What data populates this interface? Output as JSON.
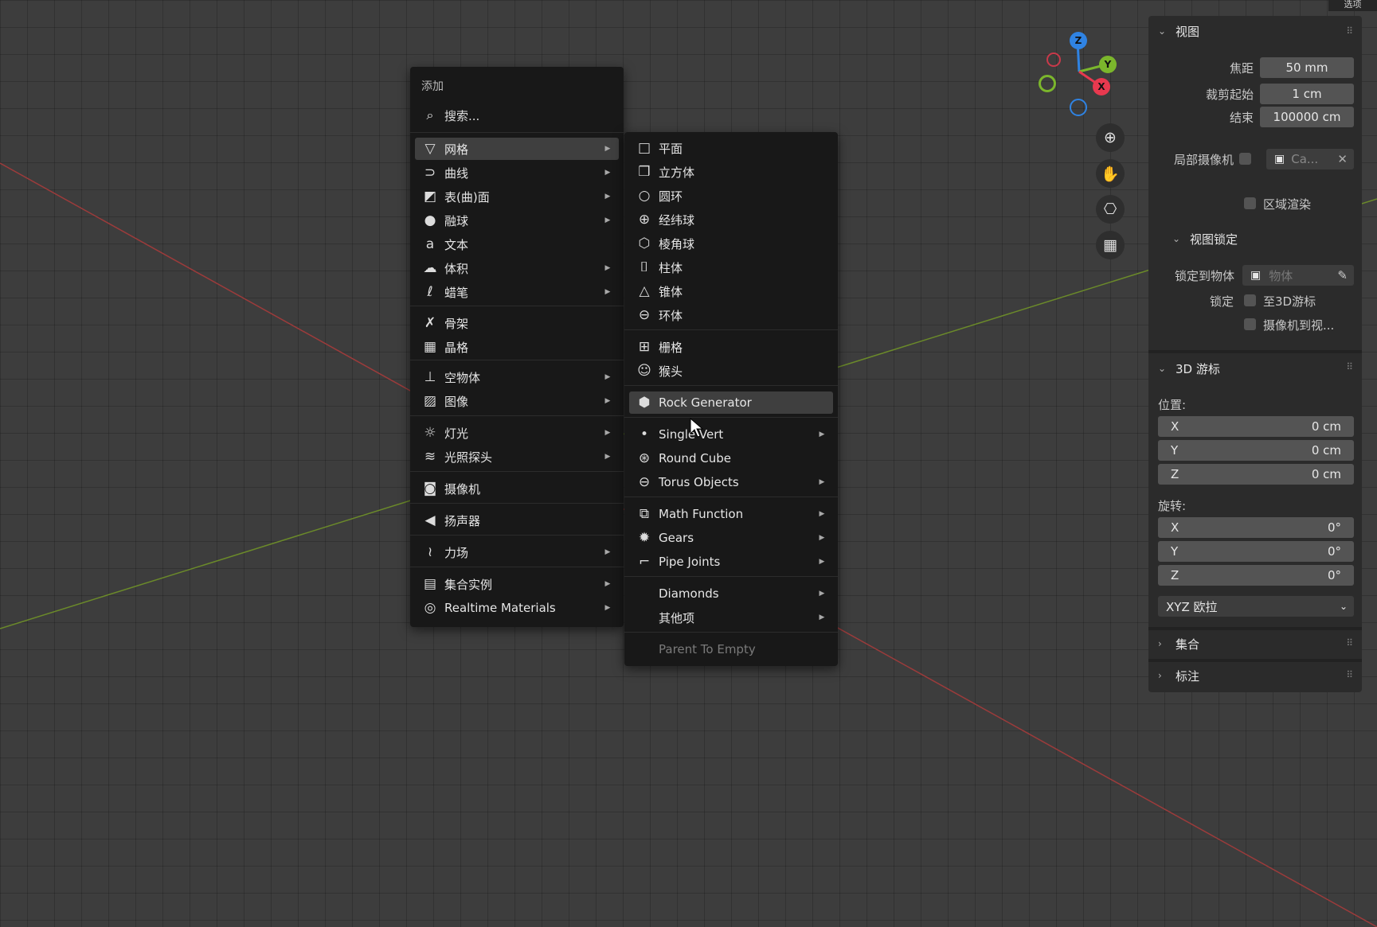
{
  "app": "Blender",
  "top_right_button": "选项",
  "add_menu": {
    "title": "添加",
    "search_placeholder": "搜索...",
    "items": [
      {
        "label": "网格",
        "icon": "mesh-icon",
        "submenu": true,
        "active": true
      },
      {
        "label": "曲线",
        "icon": "curve-icon",
        "submenu": true
      },
      {
        "label": "表(曲)面",
        "icon": "surface-icon",
        "submenu": true
      },
      {
        "label": "融球",
        "icon": "metaball-icon",
        "submenu": true
      },
      {
        "label": "文本",
        "icon": "text-icon",
        "submenu": false
      },
      {
        "label": "体积",
        "icon": "volume-icon",
        "submenu": true
      },
      {
        "label": "蜡笔",
        "icon": "grease-pencil-icon",
        "submenu": true
      },
      {
        "label": "骨架",
        "icon": "armature-icon",
        "submenu": false
      },
      {
        "label": "晶格",
        "icon": "lattice-icon",
        "submenu": false
      },
      {
        "label": "空物体",
        "icon": "empty-icon",
        "submenu": true
      },
      {
        "label": "图像",
        "icon": "image-icon",
        "submenu": true
      },
      {
        "label": "灯光",
        "icon": "light-icon",
        "submenu": true
      },
      {
        "label": "光照探头",
        "icon": "light-probe-icon",
        "submenu": true
      },
      {
        "label": "摄像机",
        "icon": "camera-icon",
        "submenu": false
      },
      {
        "label": "扬声器",
        "icon": "speaker-icon",
        "submenu": false
      },
      {
        "label": "力场",
        "icon": "force-field-icon",
        "submenu": true
      },
      {
        "label": "集合实例",
        "icon": "collection-instance-icon",
        "submenu": true
      },
      {
        "label": "Realtime Materials",
        "icon": "material-icon",
        "submenu": true
      }
    ]
  },
  "mesh_submenu": {
    "items": [
      {
        "label": "平面",
        "icon": "plane-icon",
        "submenu": false
      },
      {
        "label": "立方体",
        "icon": "cube-icon",
        "submenu": false
      },
      {
        "label": "圆环",
        "icon": "circle-icon",
        "submenu": false
      },
      {
        "label": "经纬球",
        "icon": "uv-sphere-icon",
        "submenu": false
      },
      {
        "label": "棱角球",
        "icon": "ico-sphere-icon",
        "submenu": false
      },
      {
        "label": "柱体",
        "icon": "cylinder-icon",
        "submenu": false
      },
      {
        "label": "锥体",
        "icon": "cone-icon",
        "submenu": false
      },
      {
        "label": "环体",
        "icon": "torus-icon",
        "submenu": false
      },
      {
        "label": "栅格",
        "icon": "grid-icon",
        "submenu": false
      },
      {
        "label": "猴头",
        "icon": "monkey-icon",
        "submenu": false
      },
      {
        "label": "Rock Generator",
        "icon": "rock-icon",
        "submenu": false,
        "active": true
      },
      {
        "label": "Single Vert",
        "icon": "vertex-icon",
        "submenu": true
      },
      {
        "label": "Round Cube",
        "icon": "round-cube-icon",
        "submenu": false
      },
      {
        "label": "Torus Objects",
        "icon": "torus-objects-icon",
        "submenu": true
      },
      {
        "label": "Math Function",
        "icon": "math-function-icon",
        "submenu": true
      },
      {
        "label": "Gears",
        "icon": "gear-icon",
        "submenu": true
      },
      {
        "label": "Pipe Joints",
        "icon": "pipe-joint-icon",
        "submenu": true
      },
      {
        "label": "Diamonds",
        "icon": "",
        "submenu": true
      },
      {
        "label": "其他项",
        "icon": "",
        "submenu": true
      },
      {
        "label": "Parent To Empty",
        "icon": "",
        "submenu": false,
        "disabled": true
      }
    ]
  },
  "gizmo": {
    "z": "Z",
    "y": "Y",
    "x": "X",
    "colors": {
      "x": "#e8394f",
      "y": "#7bb62c",
      "z": "#2f83e3"
    }
  },
  "viewport_tools": [
    {
      "name": "zoom-icon",
      "glyph": "⊕"
    },
    {
      "name": "hand-icon",
      "glyph": "✋"
    },
    {
      "name": "camera-view-icon",
      "glyph": "⎔"
    },
    {
      "name": "perspective-grid-icon",
      "glyph": "▦"
    }
  ],
  "sidebar": {
    "view": {
      "title": "视图",
      "focal_label": "焦距",
      "focal_value": "50 mm",
      "clip_start_label": "裁剪起始",
      "clip_start_value": "1 cm",
      "clip_end_label": "结束",
      "clip_end_value": "100000 cm",
      "local_camera_label": "局部摄像机",
      "local_camera_value": "Ca...",
      "render_region_label": "区域渲染"
    },
    "view_lock": {
      "title": "视图锁定",
      "lock_to_object_label": "锁定到物体",
      "lock_to_object_placeholder": "物体",
      "lock_label": "锁定",
      "to_3d_cursor_label": "至3D游标",
      "camera_to_view_label": "摄像机到视..."
    },
    "cursor": {
      "title": "3D 游标",
      "location_label": "位置:",
      "location": [
        {
          "axis": "X",
          "value": "0 cm"
        },
        {
          "axis": "Y",
          "value": "0 cm"
        },
        {
          "axis": "Z",
          "value": "0 cm"
        }
      ],
      "rotation_label": "旋转:",
      "rotation": [
        {
          "axis": "X",
          "value": "0°"
        },
        {
          "axis": "Y",
          "value": "0°"
        },
        {
          "axis": "Z",
          "value": "0°"
        }
      ],
      "rotation_mode": "XYZ 欧拉"
    },
    "collection_title": "集合",
    "annotation_title": "标注"
  }
}
